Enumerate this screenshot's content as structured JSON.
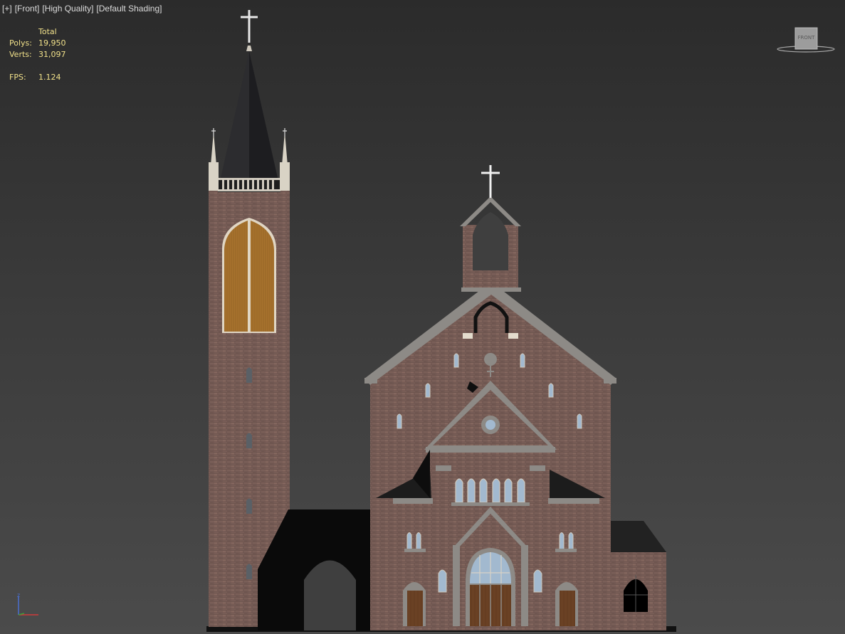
{
  "viewport": {
    "label_plus": "[+]",
    "label_view": "[Front]",
    "label_quality": "[High Quality]",
    "label_shading": "[Default Shading]"
  },
  "stats": {
    "header": "Total",
    "polys_label": "Polys:",
    "polys_value": "19,950",
    "verts_label": "Verts:",
    "verts_value": "31,097",
    "fps_label": "FPS:",
    "fps_value": "1.124"
  },
  "viewcube": {
    "face_label": "FRONT"
  },
  "axis": {
    "z_label": "z"
  },
  "colors": {
    "bg_top": "#2b2b2b",
    "bg_bottom": "#4b4b4b",
    "stats_text": "#f0e08a",
    "brick": "#7a5f58",
    "roof": "#2a2a2a",
    "trim": "#8c8a86",
    "window_glass": "#9fb8cf",
    "door_wood": "#6a4124",
    "belfry_wood": "#a7722d"
  }
}
